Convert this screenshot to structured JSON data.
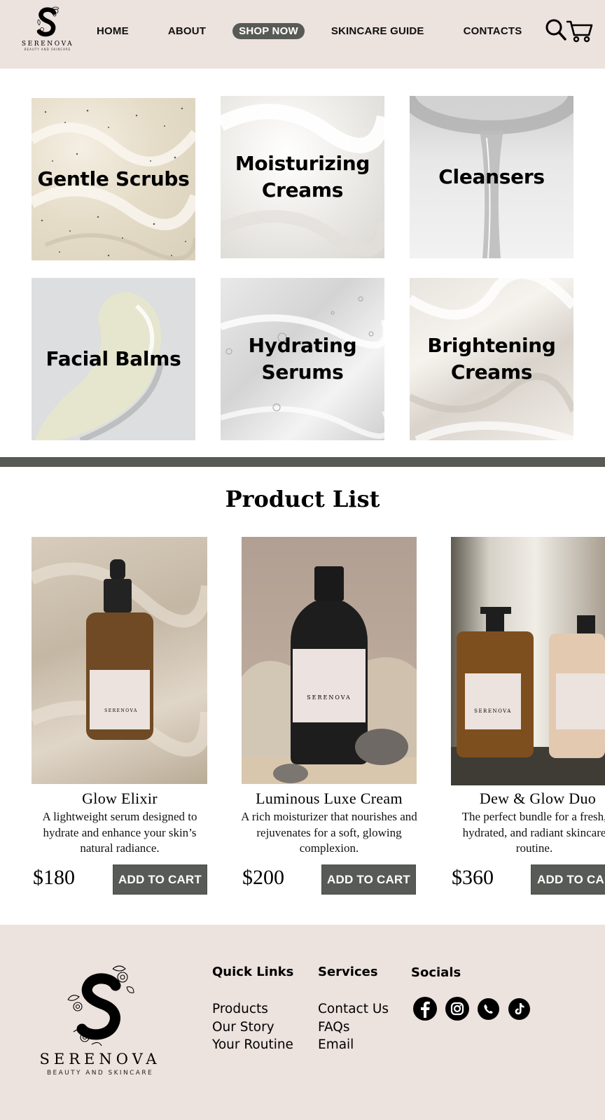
{
  "header": {
    "logo": {
      "brand": "SERENOVA",
      "tagline": "BEAUTY AND SKINCARE"
    },
    "nav": [
      {
        "label": "HOME",
        "active": false
      },
      {
        "label": "ABOUT",
        "active": false
      },
      {
        "label": "SHOP NOW",
        "active": true
      },
      {
        "label": "SKINCARE GUIDE",
        "active": false
      },
      {
        "label": "CONTACTS",
        "active": false
      }
    ],
    "icons": [
      "search-icon",
      "cart-icon"
    ]
  },
  "categories": [
    {
      "label": "Gentle Scrubs"
    },
    {
      "label": "Moisturizing\nCreams"
    },
    {
      "label": "Cleansers"
    },
    {
      "label": "Facial Balms"
    },
    {
      "label": "Hydrating\nSerums"
    },
    {
      "label": "Brightening\nCreams"
    }
  ],
  "product_section": {
    "title": "Product List",
    "products": [
      {
        "name": "Glow Elixir",
        "description": "A lightweight serum designed to hydrate and enhance your skin’s natural radiance.",
        "price": "$180",
        "button": "ADD TO CART",
        "label_brand": "SERENOVA"
      },
      {
        "name": "Luminous Luxe Cream",
        "description": "A rich moisturizer that nourishes and rejuvenates for a soft, glowing complexion.",
        "price": "$200",
        "button": "ADD TO CART",
        "label_brand": "SERENOVA"
      },
      {
        "name": "Dew & Glow Duo",
        "description": "The perfect bundle for a fresh, hydrated, and radiant skincare routine.",
        "price": "$360",
        "button": "ADD TO CART",
        "label_brand": "SERENOVA"
      }
    ]
  },
  "footer": {
    "logo": {
      "brand": "SERENOVA",
      "tagline": "BEAUTY AND SKINCARE"
    },
    "quick_links": {
      "heading": "Quick Links",
      "items": [
        "Products",
        "Our Story",
        "Your Routine"
      ]
    },
    "services": {
      "heading": "Services",
      "items": [
        "Contact Us",
        "FAQs",
        "Email"
      ]
    },
    "socials": {
      "heading": "Socials",
      "icons": [
        "facebook-icon",
        "instagram-icon",
        "whatsapp-icon",
        "tiktok-icon"
      ]
    }
  },
  "colors": {
    "header_bg": "#ece2de",
    "accent_dark": "#575a55",
    "text": "#000000"
  }
}
